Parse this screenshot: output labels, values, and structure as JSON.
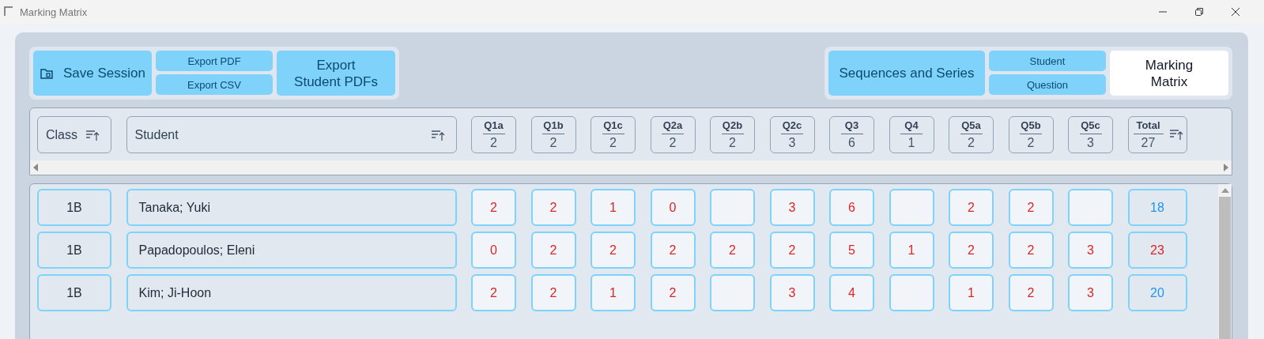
{
  "window": {
    "title": "Marking Matrix"
  },
  "toolbar": {
    "save_button": "Save Session",
    "export_buttons": [
      "Export PDF",
      "Export CSV"
    ],
    "export_student_button": "Export Student PDFs"
  },
  "topic_button": "Sequences and Series",
  "view_tabs": [
    {
      "label": "Student",
      "kind": "stacked",
      "selected": false
    },
    {
      "label": "Question",
      "kind": "stacked",
      "selected": false
    },
    {
      "label": "Marking Matrix",
      "kind": "block",
      "selected": true
    }
  ],
  "table": {
    "columns": [
      {
        "kind": "text",
        "label": "Class",
        "sortable": true
      },
      {
        "kind": "text",
        "label": "Student",
        "sortable": true
      },
      {
        "kind": "question",
        "label": "Q1a",
        "max": "2"
      },
      {
        "kind": "question",
        "label": "Q1b",
        "max": "2"
      },
      {
        "kind": "question",
        "label": "Q1c",
        "max": "2"
      },
      {
        "kind": "question",
        "label": "Q2a",
        "max": "2"
      },
      {
        "kind": "question",
        "label": "Q2b",
        "max": "2"
      },
      {
        "kind": "question",
        "label": "Q2c",
        "max": "3"
      },
      {
        "kind": "question",
        "label": "Q3",
        "max": "6"
      },
      {
        "kind": "question",
        "label": "Q4",
        "max": "1"
      },
      {
        "kind": "question",
        "label": "Q5a",
        "max": "2"
      },
      {
        "kind": "question",
        "label": "Q5b",
        "max": "2"
      },
      {
        "kind": "question",
        "label": "Q5c",
        "max": "3"
      },
      {
        "kind": "total",
        "label": "Total",
        "max": "27",
        "sortable": true
      }
    ],
    "rows": [
      {
        "class": "1B",
        "student": "Tanaka; Yuki",
        "scores": [
          {
            "kind": "mark",
            "value": "2"
          },
          {
            "kind": "mark",
            "value": "2"
          },
          {
            "kind": "mark",
            "value": "1"
          },
          {
            "kind": "mark",
            "value": "0"
          },
          {
            "kind": "empty"
          },
          {
            "kind": "mark",
            "value": "3"
          },
          {
            "kind": "mark",
            "value": "6"
          },
          {
            "kind": "empty"
          },
          {
            "kind": "mark",
            "value": "2"
          },
          {
            "kind": "mark",
            "value": "2"
          },
          {
            "kind": "empty"
          }
        ],
        "total": {
          "value": "18",
          "color": "#1e96f0"
        }
      },
      {
        "class": "1B",
        "student": "Papadopoulos; Eleni",
        "scores": [
          {
            "kind": "mark",
            "value": "0"
          },
          {
            "kind": "mark",
            "value": "2"
          },
          {
            "kind": "mark",
            "value": "2"
          },
          {
            "kind": "mark",
            "value": "2"
          },
          {
            "kind": "mark",
            "value": "2"
          },
          {
            "kind": "mark",
            "value": "2"
          },
          {
            "kind": "mark",
            "value": "5"
          },
          {
            "kind": "mark",
            "value": "1"
          },
          {
            "kind": "mark",
            "value": "2"
          },
          {
            "kind": "mark",
            "value": "2"
          },
          {
            "kind": "mark",
            "value": "3"
          }
        ],
        "total": {
          "value": "23",
          "color": "#dc2626"
        }
      },
      {
        "class": "1B",
        "student": "Kim; Ji-Hoon",
        "scores": [
          {
            "kind": "mark",
            "value": "2"
          },
          {
            "kind": "mark",
            "value": "2"
          },
          {
            "kind": "mark",
            "value": "1"
          },
          {
            "kind": "mark",
            "value": "2"
          },
          {
            "kind": "empty"
          },
          {
            "kind": "mark",
            "value": "3"
          },
          {
            "kind": "mark",
            "value": "4"
          },
          {
            "kind": "empty"
          },
          {
            "kind": "mark",
            "value": "1"
          },
          {
            "kind": "mark",
            "value": "2"
          },
          {
            "kind": "mark",
            "value": "3"
          }
        ],
        "total": {
          "value": "20",
          "color": "#1e96f0"
        }
      }
    ]
  }
}
